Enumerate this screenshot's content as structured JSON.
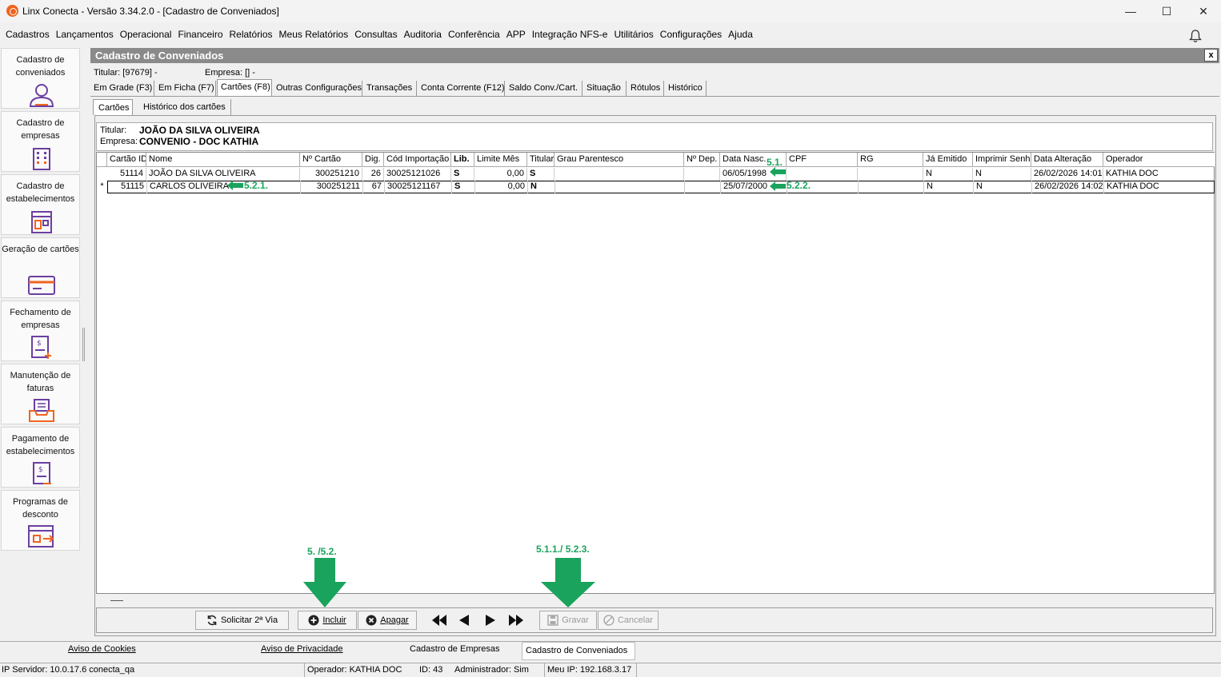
{
  "window": {
    "title": "Linx Conecta - Versão 3.34.2.0 - [Cadastro de Conveniados]",
    "minimize": "—",
    "maximize": "☐",
    "close": "✕"
  },
  "menu": [
    "Cadastros",
    "Lançamentos",
    "Operacional",
    "Financeiro",
    "Relatórios",
    "Meus Relatórios",
    "Consultas",
    "Auditoria",
    "Conferência",
    "APP",
    "Integração NFS-e",
    "Utilitários",
    "Configurações",
    "Ajuda"
  ],
  "sidebar": [
    {
      "label": "Cadastro de conveniados",
      "icon": "user-icon"
    },
    {
      "label": "Cadastro de empresas",
      "icon": "building-icon"
    },
    {
      "label": "Cadastro de estabelecimentos",
      "icon": "store-icon"
    },
    {
      "label": "Geração de cartões",
      "icon": "card-icon"
    },
    {
      "label": "Fechamento de empresas",
      "icon": "invoice-icon"
    },
    {
      "label": "Manutenção de faturas",
      "icon": "tray-icon"
    },
    {
      "label": "Pagamento de estabelecimentos",
      "icon": "payment-icon"
    },
    {
      "label": "Programas de desconto",
      "icon": "discount-icon"
    }
  ],
  "panel": {
    "title": "Cadastro de Conveniados",
    "close": "x",
    "titular_info": "Titular: [97679] -",
    "empresa_info": "Empresa: [] -"
  },
  "tabs": [
    "Em Grade (F3)",
    "Em Ficha (F7)",
    "Cartões (F8)",
    "Outras Configurações",
    "Transações",
    "Conta Corrente (F12)",
    "Saldo Conv./Cart.",
    "Situação",
    "Rótulos",
    "Histórico"
  ],
  "subtabs": [
    "Cartões",
    "Histórico dos cartões"
  ],
  "info": {
    "titular_label": "Titular:",
    "titular_value": "JOÃO DA SILVA OLIVEIRA",
    "empresa_label": "Empresa:",
    "empresa_value": "CONVENIO -  DOC KATHIA"
  },
  "grid": {
    "columns": [
      "Cartão ID",
      "Nome",
      "Nº Cartão",
      "Dig.",
      "Cód Importação",
      "Lib.",
      "Limite Mês",
      "Titular",
      "Grau Parentesco",
      "Nº Dep.",
      "Data Nasc.",
      "CPF",
      "RG",
      "Já Emitido",
      "Imprimir Senha",
      "Data Alteração",
      "Operador"
    ],
    "rows": [
      {
        "marker": "",
        "cells": [
          "51114",
          "JOÃO DA SILVA OLIVEIRA",
          "300251210",
          "26",
          "30025121026",
          "S",
          "0,00",
          "S",
          "",
          "",
          "06/05/1998",
          "",
          "",
          "N",
          "N",
          "26/02/2026 14:01",
          "KATHIA DOC"
        ]
      },
      {
        "marker": "*",
        "cells": [
          "51115",
          "CARLOS OLIVEIRA",
          "300251211",
          "67",
          "30025121167",
          "S",
          "0,00",
          "N",
          "",
          "",
          "25/07/2000",
          "",
          "",
          "N",
          "N",
          "26/02/2026 14:02",
          "KATHIA DOC"
        ]
      }
    ]
  },
  "annotations": {
    "a51": "5.1.",
    "a521": "5.2.1.",
    "a522": "5.2.2.",
    "a5_52": "5. /5.2.",
    "a511_523": "5.1.1./ 5.2.3."
  },
  "toolbar": {
    "solicitar": "Solicitar 2ª Via",
    "incluir": "Incluir",
    "apagar": "Apagar",
    "gravar": "Gravar",
    "cancelar": "Cancelar"
  },
  "status1": {
    "cookies": "Aviso de Cookies",
    "privacidade": "Aviso de Privacidade",
    "empresas_tab": "Cadastro de Empresas",
    "conveniados_tab": "Cadastro de Conveniados"
  },
  "status2": {
    "servidor": "IP Servidor: 10.0.17.6 conecta_qa",
    "operador": "Operador: KATHIA DOC",
    "id": "ID: 43",
    "admin": "Administrador: Sim",
    "ip": "Meu IP: 192.168.3.17"
  },
  "colors": {
    "annotation": "#1aa35c",
    "panel_title": "#8a8a8a",
    "icon_purple": "#6b3fa0",
    "icon_orange": "#f0641e"
  }
}
